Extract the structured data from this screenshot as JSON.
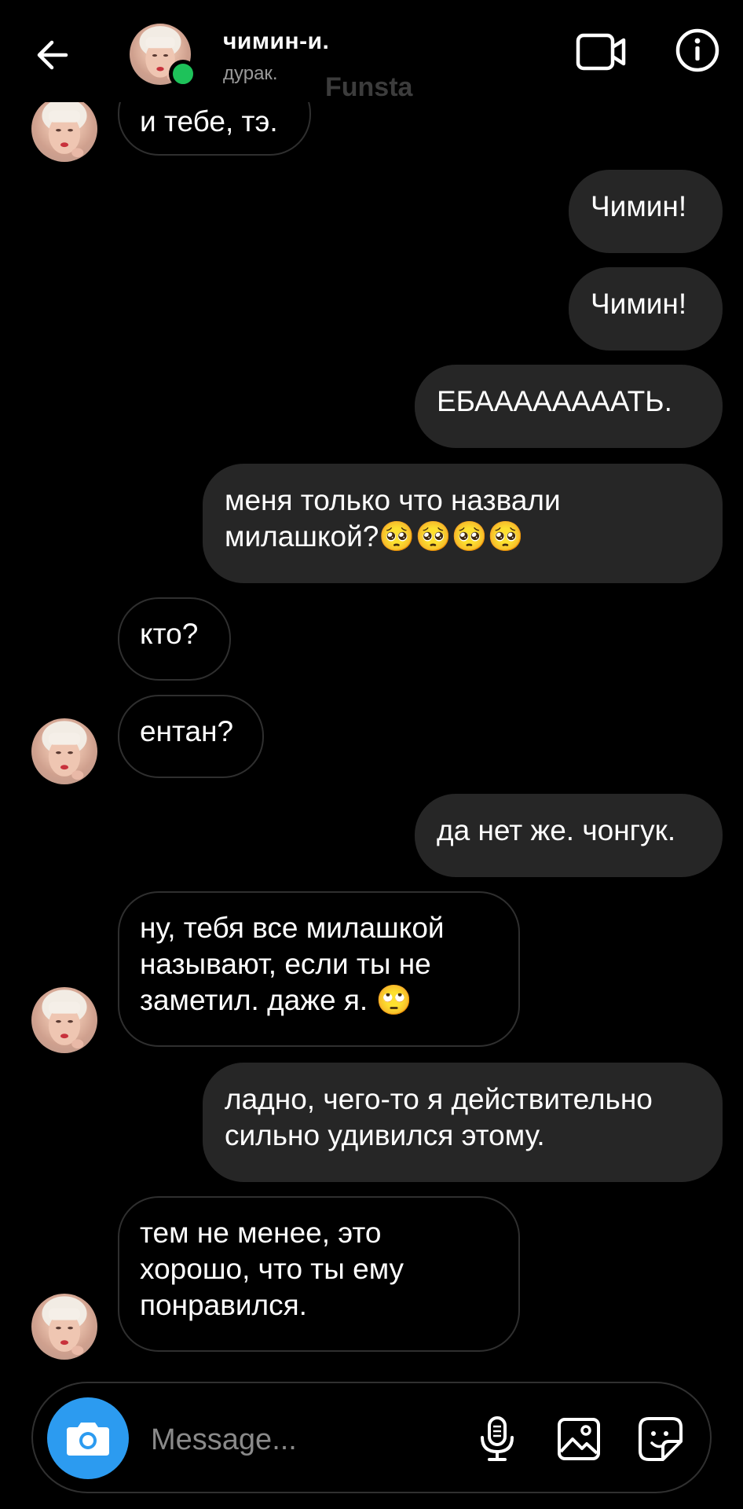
{
  "header": {
    "contact_name": "чимин-и.",
    "contact_status": "дурак.",
    "watermark": "Funsta",
    "icons": {
      "back": "arrow-left-icon",
      "video": "video-camera-icon",
      "info": "info-icon"
    },
    "online_color": "#1ec25a"
  },
  "messages": [
    {
      "side": "in",
      "text": "и тебе, тэ.",
      "avatar": true
    },
    {
      "side": "out",
      "text": "Чимин!"
    },
    {
      "side": "out",
      "text": "Чимин!"
    },
    {
      "side": "out",
      "text": "ЕБААААААААТЬ."
    },
    {
      "side": "out",
      "text": "меня только что назвали\nмилашкой?🥺🥺🥺🥺"
    },
    {
      "side": "in",
      "text": "кто?",
      "avatar": false
    },
    {
      "side": "in",
      "text": "ентан?",
      "avatar": true
    },
    {
      "side": "out",
      "text": "да нет же. чонгук."
    },
    {
      "side": "in",
      "text": "ну, тебя все милашкой\nназывают, если ты не\nзаметил. даже я. 🙄",
      "avatar": true
    },
    {
      "side": "out",
      "text": "ладно, чего-то я действительно\nсильно удивился этому."
    },
    {
      "side": "in",
      "text": "тем не менее, это\nхорошо, что ты ему\nпонравился.",
      "avatar": true
    }
  ],
  "composer": {
    "placeholder": "Message...",
    "value": "",
    "icons": {
      "camera": "camera-icon",
      "mic": "microphone-icon",
      "gallery": "image-icon",
      "sticker": "sticker-icon"
    },
    "camera_color": "#2c9bf0"
  }
}
